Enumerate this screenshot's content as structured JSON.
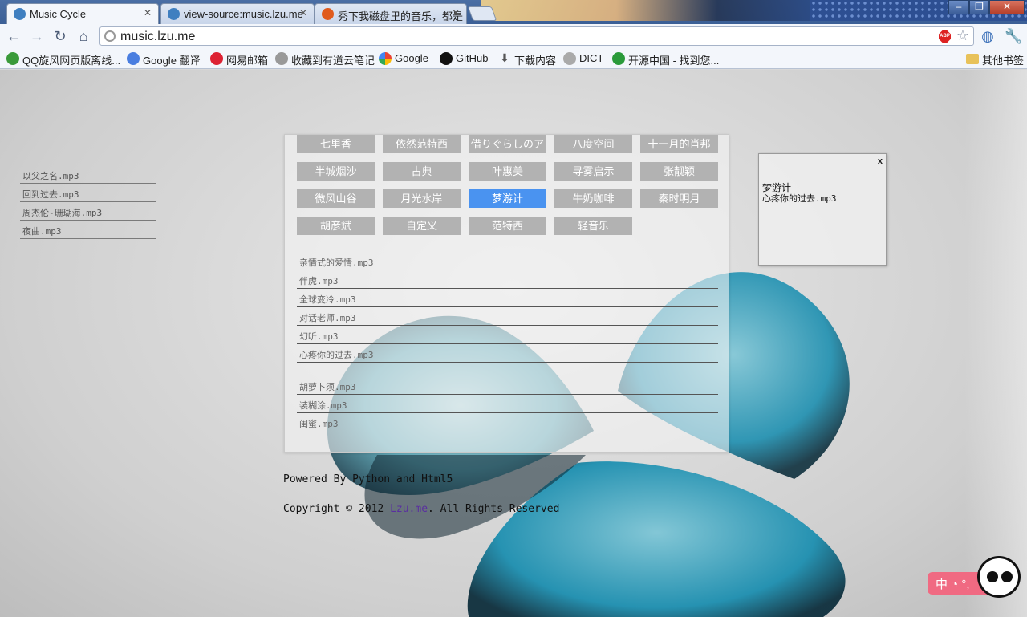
{
  "browser": {
    "tabs": [
      {
        "title": "Music Cycle",
        "favicon_color": "#3f7fc0"
      },
      {
        "title": "view-source:music.lzu.me",
        "favicon_color": "#3f7fc0"
      },
      {
        "title": "秀下我磁盘里的音乐，都是",
        "favicon_color": "#e05a1c"
      }
    ],
    "url": "music.lzu.me",
    "bookmarks": [
      {
        "label": "QQ旋风网页版离线...",
        "icon_color": "#3a9a3a"
      },
      {
        "label": "Google 翻译",
        "icon_color": "#4a7ee0"
      },
      {
        "label": "网易邮箱",
        "icon_color": "#d23"
      },
      {
        "label": "收藏到有道云笔记",
        "icon_color": "#999"
      },
      {
        "label": "Google",
        "icon_color": "#4285f4"
      },
      {
        "label": "GitHub",
        "icon_color": "#111"
      },
      {
        "label": "下载内容",
        "icon_color": "#555"
      },
      {
        "label": "DICT",
        "icon_color": "#aaa"
      },
      {
        "label": "开源中国 - 找到您...",
        "icon_color": "#2a9a3a"
      }
    ],
    "other_bookmarks": "其他书签",
    "abp_label": "ABP"
  },
  "left_playlist": [
    "以父之名.mp3",
    "回到过去.mp3",
    "周杰伦-珊瑚海.mp3",
    "夜曲.mp3"
  ],
  "tags": [
    {
      "label": "七里香",
      "selected": false
    },
    {
      "label": "依然范特西",
      "selected": false
    },
    {
      "label": "借りぐらしのア",
      "selected": false
    },
    {
      "label": "八度空间",
      "selected": false
    },
    {
      "label": "十一月的肖邦",
      "selected": false
    },
    {
      "label": "半城烟沙",
      "selected": false
    },
    {
      "label": "古典",
      "selected": false
    },
    {
      "label": "叶惠美",
      "selected": false
    },
    {
      "label": "寻雾启示",
      "selected": false
    },
    {
      "label": "张靓颖",
      "selected": false
    },
    {
      "label": "微风山谷",
      "selected": false
    },
    {
      "label": "月光水岸",
      "selected": false
    },
    {
      "label": "梦游计",
      "selected": true
    },
    {
      "label": "牛奶咖啡",
      "selected": false
    },
    {
      "label": "秦时明月",
      "selected": false
    },
    {
      "label": "胡彦斌",
      "selected": false
    },
    {
      "label": "自定义",
      "selected": false
    },
    {
      "label": "范特西",
      "selected": false
    },
    {
      "label": "轻音乐",
      "selected": false
    }
  ],
  "songs_group1": [
    "亲情式的爱情.mp3",
    "伴虎.mp3",
    "全球变冷.mp3",
    "对话老师.mp3",
    "幻听.mp3",
    "心疼你的过去.mp3"
  ],
  "songs_group2": [
    "胡萝卜须.mp3",
    "装糊涂.mp3",
    "闺蜜.mp3"
  ],
  "footer": {
    "powered": "Powered By Python and Html5",
    "copyright_prefix": "Copyright © 2012 ",
    "copyright_link": "Lzu.me",
    "copyright_suffix": ". All Rights Reserved"
  },
  "now_playing": {
    "close": "x",
    "album": "梦游计",
    "file": "心疼你的过去.mp3"
  },
  "ime": {
    "label": "中 ◔ °,"
  },
  "colors": {
    "selected_tag": "#4a93f0",
    "tag": "#b2b2b2",
    "link": "#5a2fa0"
  }
}
